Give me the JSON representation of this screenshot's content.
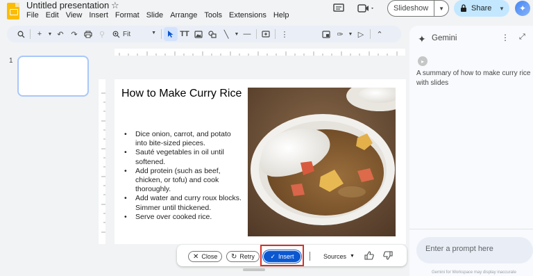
{
  "app": {
    "title": "Untitled presentation",
    "star_icon": "star-icon",
    "menus": [
      "File",
      "Edit",
      "View",
      "Insert",
      "Format",
      "Slide",
      "Arrange",
      "Tools",
      "Extensions",
      "Help"
    ]
  },
  "header": {
    "slideshow_label": "Slideshow",
    "share_label": "Share"
  },
  "toolbar": {
    "zoom_label": "Fit"
  },
  "filmstrip": {
    "slide_number": "1"
  },
  "slide": {
    "title": "How to Make Curry Rice",
    "bullets": [
      "Dice onion, carrot, and potato into bite-sized pieces.",
      "Sauté vegetables in oil until softened.",
      "Add protein (such as beef, chicken, or tofu) and cook thoroughly.",
      "Add water and curry roux blocks. Simmer until thickened.",
      "Serve over cooked rice."
    ]
  },
  "action_bar": {
    "close_label": "Close",
    "retry_label": "Retry",
    "insert_label": "Insert",
    "sources_label": "Sources"
  },
  "gemini": {
    "title": "Gemini",
    "user_message": "A summary of how to make curry rice with slides",
    "prompt_placeholder": "Enter a prompt here",
    "disclaimer": "Gemini for Workspace may display inaccurate"
  },
  "colors": {
    "accent": "#0b57d0",
    "share_bg": "#c2e7ff",
    "highlight": "#d93025",
    "app_icon": "#fbbc04"
  }
}
